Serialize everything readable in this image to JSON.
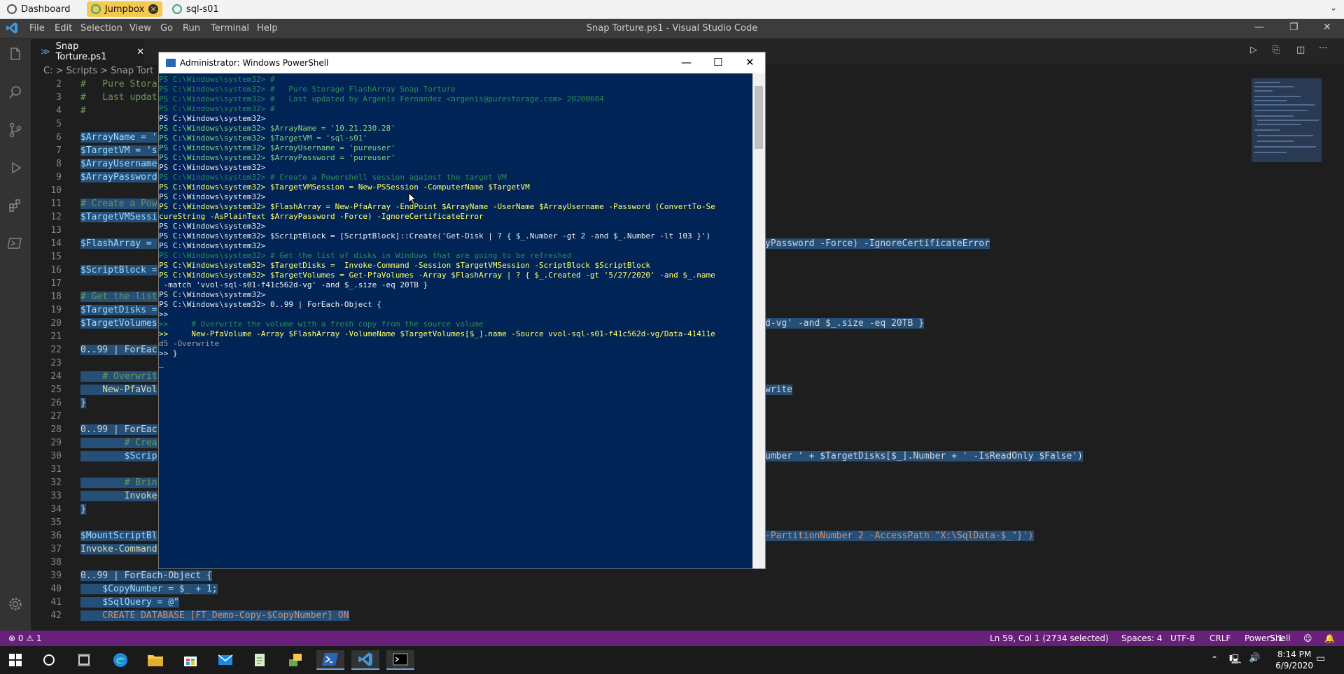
{
  "browser_tabs": [
    {
      "label": "Dashboard",
      "active": false
    },
    {
      "label": "Jumpbox",
      "active": true
    },
    {
      "label": "sql-s01",
      "active": false
    }
  ],
  "menu": [
    "File",
    "Edit",
    "Selection",
    "View",
    "Go",
    "Run",
    "Terminal",
    "Help"
  ],
  "window_title": "Snap Torture.ps1 - Visual Studio Code",
  "editor_tab": "Snap Torture.ps1",
  "breadcrumb": "C: > Scripts > Snap Tort",
  "editor": {
    "lines": [
      {
        "n": "2",
        "t": "#   Pure Stora"
      },
      {
        "n": "3",
        "t": "#   Last updat"
      },
      {
        "n": "4",
        "t": "#"
      },
      {
        "n": "5",
        "t": ""
      },
      {
        "n": "6",
        "t": "$ArrayName = '"
      },
      {
        "n": "7",
        "t": "$TargetVM = 's"
      },
      {
        "n": "8",
        "t": "$ArrayUsername"
      },
      {
        "n": "9",
        "t": "$ArrayPassword"
      },
      {
        "n": "10",
        "t": ""
      },
      {
        "n": "11",
        "t": "# Create a Pow"
      },
      {
        "n": "12",
        "t": "$TargetVMSessi"
      },
      {
        "n": "13",
        "t": ""
      },
      {
        "n": "14",
        "t": "$FlashArray = "
      },
      {
        "n": "15",
        "t": ""
      },
      {
        "n": "16",
        "t": "$ScriptBlock ="
      },
      {
        "n": "17",
        "t": ""
      },
      {
        "n": "18",
        "t": "# Get the list"
      },
      {
        "n": "19",
        "t": "$TargetDisks ="
      },
      {
        "n": "20",
        "t": "$TargetVolumes"
      },
      {
        "n": "21",
        "t": ""
      },
      {
        "n": "22",
        "t": "0..99 | ForEac"
      },
      {
        "n": "23",
        "t": ""
      },
      {
        "n": "24",
        "t": "    # Overwrit"
      },
      {
        "n": "25",
        "t": "    New-PfaVol"
      },
      {
        "n": "26",
        "t": "}"
      },
      {
        "n": "27",
        "t": ""
      },
      {
        "n": "28",
        "t": "0..99 | ForEac"
      },
      {
        "n": "29",
        "t": "        # Crea"
      },
      {
        "n": "30",
        "t": "        $Scrip"
      },
      {
        "n": "31",
        "t": ""
      },
      {
        "n": "32",
        "t": "        # Brin"
      },
      {
        "n": "33",
        "t": "        Invoke"
      },
      {
        "n": "34",
        "t": "}"
      },
      {
        "n": "35",
        "t": ""
      },
      {
        "n": "36",
        "t": "$MountScriptBl"
      },
      {
        "n": "37",
        "t": "Invoke-Command"
      },
      {
        "n": "38",
        "t": ""
      },
      {
        "n": "39",
        "t": "0..99 | ForEach-Object {"
      },
      {
        "n": "40",
        "t": "    $CopyNumber = $_ + 1;"
      },
      {
        "n": "41",
        "t": "    $SqlQuery = @\""
      },
      {
        "n": "42",
        "t": "    CREATE DATABASE [FT_Demo-Copy-$CopyNumber] ON"
      }
    ],
    "right_fragments": {
      "l14": "yPassword -Force) -IgnoreCertificateError",
      "l20": "d-vg' -and $_.size -eq 20TB }",
      "l25": "write",
      "l30": "umber ' + $TargetDisks[$_].Number + ' -IsReadOnly $False')",
      "l36": "-PartitionNumber 2 -AccessPath \"X:\\SqlData-$_\"}')"
    }
  },
  "powershell": {
    "title": "Administrator: Windows PowerShell",
    "lines": [
      "PS C:\\Windows\\system32> #",
      "PS C:\\Windows\\system32> #   Pure Storage FlashArray Snap Torture",
      "PS C:\\Windows\\system32> #   Last updated by Argenis Fernandez <argenis@purestorage.com> 20200604",
      "PS C:\\Windows\\system32> #",
      "PS C:\\Windows\\system32>",
      "PS C:\\Windows\\system32> $ArrayName = '10.21.230.28'",
      "PS C:\\Windows\\system32> $TargetVM = 'sql-s01'",
      "PS C:\\Windows\\system32> $ArrayUsername = 'pureuser'",
      "PS C:\\Windows\\system32> $ArrayPassword = 'pureuser'",
      "PS C:\\Windows\\system32>",
      "PS C:\\Windows\\system32> # Create a Powershell session against the target VM",
      "PS C:\\Windows\\system32> $TargetVMSession = New-PSSession -ComputerName $TargetVM",
      "PS C:\\Windows\\system32>",
      "PS C:\\Windows\\system32> $FlashArray = New-PfaArray -EndPoint $ArrayName -UserName $ArrayUsername -Password (ConvertTo-Se",
      "cureString -AsPlainText $ArrayPassword -Force) -IgnoreCertificateError",
      "PS C:\\Windows\\system32>",
      "PS C:\\Windows\\system32> $ScriptBlock = [ScriptBlock]::Create('Get-Disk | ? { $_.Number -gt 2 -and $_.Number -lt 103 }')",
      "PS C:\\Windows\\system32>",
      "PS C:\\Windows\\system32> # Get the list of disks in Windows that are going to be refreshed",
      "PS C:\\Windows\\system32> $TargetDisks =  Invoke-Command -Session $TargetVMSession -ScriptBlock $ScriptBlock",
      "PS C:\\Windows\\system32> $TargetVolumes = Get-PfaVolumes -Array $FlashArray | ? { $_.Created -gt '5/27/2020' -and $_.name",
      " -match 'vvol-sql-s01-f41c562d-vg' -and $_.size -eq 20TB }",
      "PS C:\\Windows\\system32>",
      "PS C:\\Windows\\system32> 0..99 | ForEach-Object {",
      ">>",
      ">>     # Overwrite the volume with a fresh copy from the source volume",
      ">>     New-PfaVolume -Array $FlashArray -VolumeName $TargetVolumes[$_].name -Source vvol-sql-s01-f41c562d-vg/Data-41411e",
      "d5 -Overwrite",
      ">> }",
      "_"
    ]
  },
  "status": {
    "problems": "⊗ 0 ⚠ 1",
    "position": "Ln 59, Col 1 (2734 selected)",
    "spaces": "Spaces: 4",
    "encoding": "UTF-8",
    "eol": "CRLF",
    "language": "PowerShell",
    "version": "5.1"
  },
  "clock": {
    "time": "8:14 PM",
    "date": "6/9/2020"
  },
  "colors": {
    "statusbar": "#68217a",
    "ps_bg": "#012456",
    "editor_bg": "#1e1e1e",
    "active_tab": "#f5c94f"
  }
}
